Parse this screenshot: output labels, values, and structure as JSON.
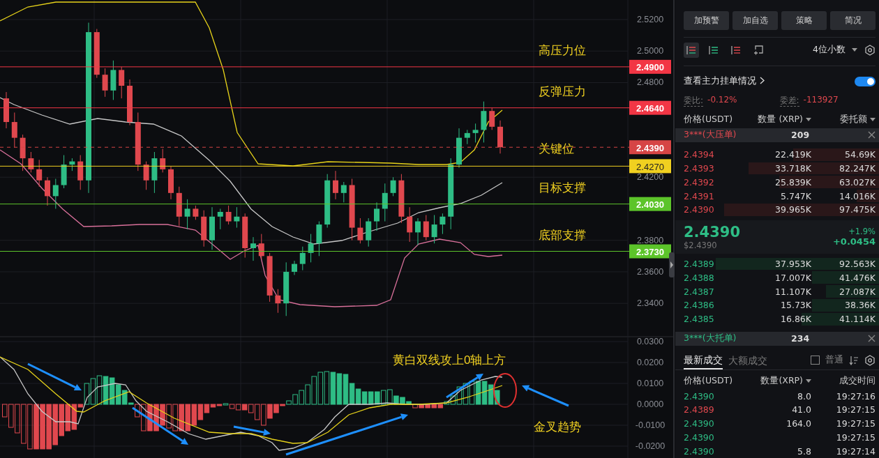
{
  "chart": {
    "price_axis": [
      "2.5200",
      "2.5000",
      "2.4800",
      "2.4200",
      "2.3800",
      "2.3600",
      "2.3400"
    ],
    "levels": [
      {
        "price": "2.4900",
        "kind": "solid",
        "color": "#f23645",
        "label": "高压力位"
      },
      {
        "price": "2.4640",
        "kind": "solid",
        "color": "#f23645",
        "label": "反弹压力"
      },
      {
        "price": "2.4390",
        "kind": "dashed",
        "color": "#d64545",
        "label": "关键位"
      },
      {
        "price": "2.4270",
        "kind": "solid",
        "color": "#f0d020"
      },
      {
        "price": "2.4030",
        "kind": "solid",
        "color": "#5cc42a",
        "label": "目标支撑"
      },
      {
        "price": "2.3730",
        "kind": "solid",
        "color": "#5cc42a",
        "label": "底部支撑"
      }
    ],
    "macd_axis": [
      "0.0300",
      "0.0200",
      "0.0100",
      "0.0000",
      "-0.0100",
      "-0.0200"
    ],
    "annotations": [
      "黄白双线攻上0轴上方",
      "金叉趋势"
    ]
  },
  "panel": {
    "buttons": [
      "加预警",
      "加自选",
      "策略",
      "简况"
    ],
    "view_tools": [
      {
        "selected": true
      },
      {
        "selected": false
      },
      {
        "selected": false
      },
      {
        "selected": false
      }
    ],
    "precision": "4位小数",
    "main_orders": {
      "label": "查看主力挂单情况",
      "on": true
    },
    "ratio": {
      "label": "委比:",
      "value": "-0.12%"
    },
    "diff": {
      "label": "委差:",
      "value": "-113927"
    },
    "columns": [
      "价格(USDT)",
      "数量 (XRP)",
      "委托额"
    ],
    "ask_banner": {
      "label": "3***(大压单)",
      "count": "209"
    },
    "asks": [
      {
        "price": "2.4394",
        "qty": "22.419K",
        "amount": "54.69K",
        "level": 0.42
      },
      {
        "price": "2.4393",
        "qty": "33.718K",
        "amount": "82.247K",
        "level": 0.64
      },
      {
        "price": "2.4392",
        "qty": "25.839K",
        "amount": "63.027K",
        "level": 0.49
      },
      {
        "price": "2.4391",
        "qty": "5.747K",
        "amount": "14.016K",
        "level": 0.11
      },
      {
        "price": "2.4390",
        "qty": "39.965K",
        "amount": "97.475K",
        "level": 0.76
      }
    ],
    "last": {
      "price": "2.4390",
      "usd": "$2.4390",
      "pct": "+1.9%",
      "change": "+0.0454"
    },
    "bids": [
      {
        "price": "2.4389",
        "qty": "37.953K",
        "amount": "92.563K",
        "level": 0.8
      },
      {
        "price": "2.4388",
        "qty": "17.007K",
        "amount": "41.476K",
        "level": 0.33
      },
      {
        "price": "2.4387",
        "qty": "11.107K",
        "amount": "27.087K",
        "level": 0.26
      },
      {
        "price": "2.4386",
        "qty": "15.73K",
        "amount": "38.36K",
        "level": 0.33
      },
      {
        "price": "2.4385",
        "qty": "16.86K",
        "amount": "41.114K",
        "level": 0.38
      }
    ],
    "bid_banner": {
      "label": "3***(大托单)",
      "count": "234"
    },
    "trade_tabs": [
      {
        "label": "最新成交",
        "selected": true
      },
      {
        "label": "大额成交",
        "selected": false
      }
    ],
    "normal": {
      "label": "普通",
      "checked": false
    },
    "trade_columns": [
      "价格(USDT)",
      "数量(XRP)",
      "成交时间"
    ],
    "trades": [
      {
        "price": "2.4390",
        "qty": "8.0",
        "time": "19:27:16",
        "color": "#2ebd85"
      },
      {
        "price": "2.4389",
        "qty": "41.0",
        "time": "19:27:15",
        "color": "#e0484e"
      },
      {
        "price": "2.4390",
        "qty": "164.0",
        "time": "19:27:15",
        "color": "#2ebd85"
      },
      {
        "price": "2.4390",
        "time": "19:27:15",
        "color": "#2ebd85"
      },
      {
        "price": "2.4390",
        "qty": "5.8",
        "time": "19:27:14",
        "color": "#2ebd85"
      }
    ]
  }
}
